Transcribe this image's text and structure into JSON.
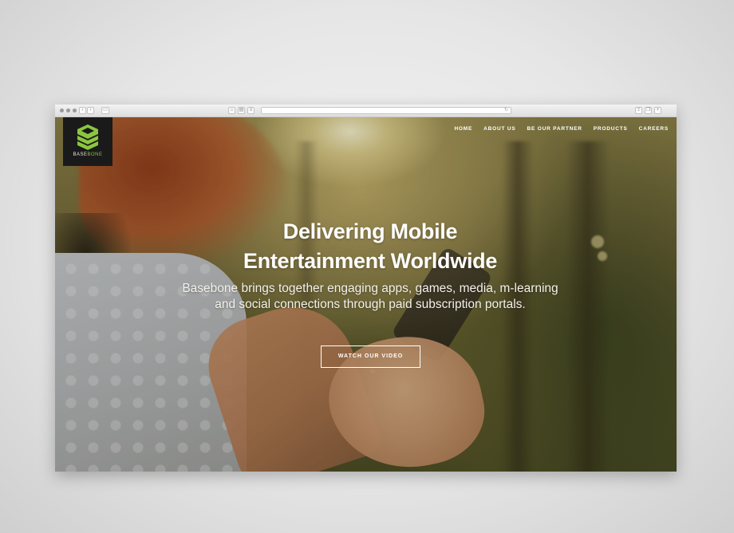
{
  "site": {
    "logo_text_left": "BASE",
    "logo_text_right": "BONE",
    "logo_icon": "layered-stack-icon",
    "brand_color": "#8cc63f"
  },
  "nav": {
    "items": [
      {
        "label": "HOME"
      },
      {
        "label": "ABOUT US"
      },
      {
        "label": "BE OUR PARTNER"
      },
      {
        "label": "PRODUCTS"
      },
      {
        "label": "CAREERS"
      }
    ]
  },
  "hero": {
    "title_line1": "Delivering Mobile",
    "title_line2": "Entertainment Worldwide",
    "subtitle": "Basebone brings together engaging apps, games, media, m-learning and social connections through paid subscription portals.",
    "cta_label": "WATCH OUR VIDEO"
  },
  "browser": {
    "icons": [
      "back-arrow-icon",
      "forward-arrow-icon",
      "sidebar-icon",
      "home-icon",
      "bookmarks-icon",
      "reader-icon",
      "reload-icon",
      "share-icon",
      "tabs-icon",
      "add-tab-icon"
    ]
  }
}
